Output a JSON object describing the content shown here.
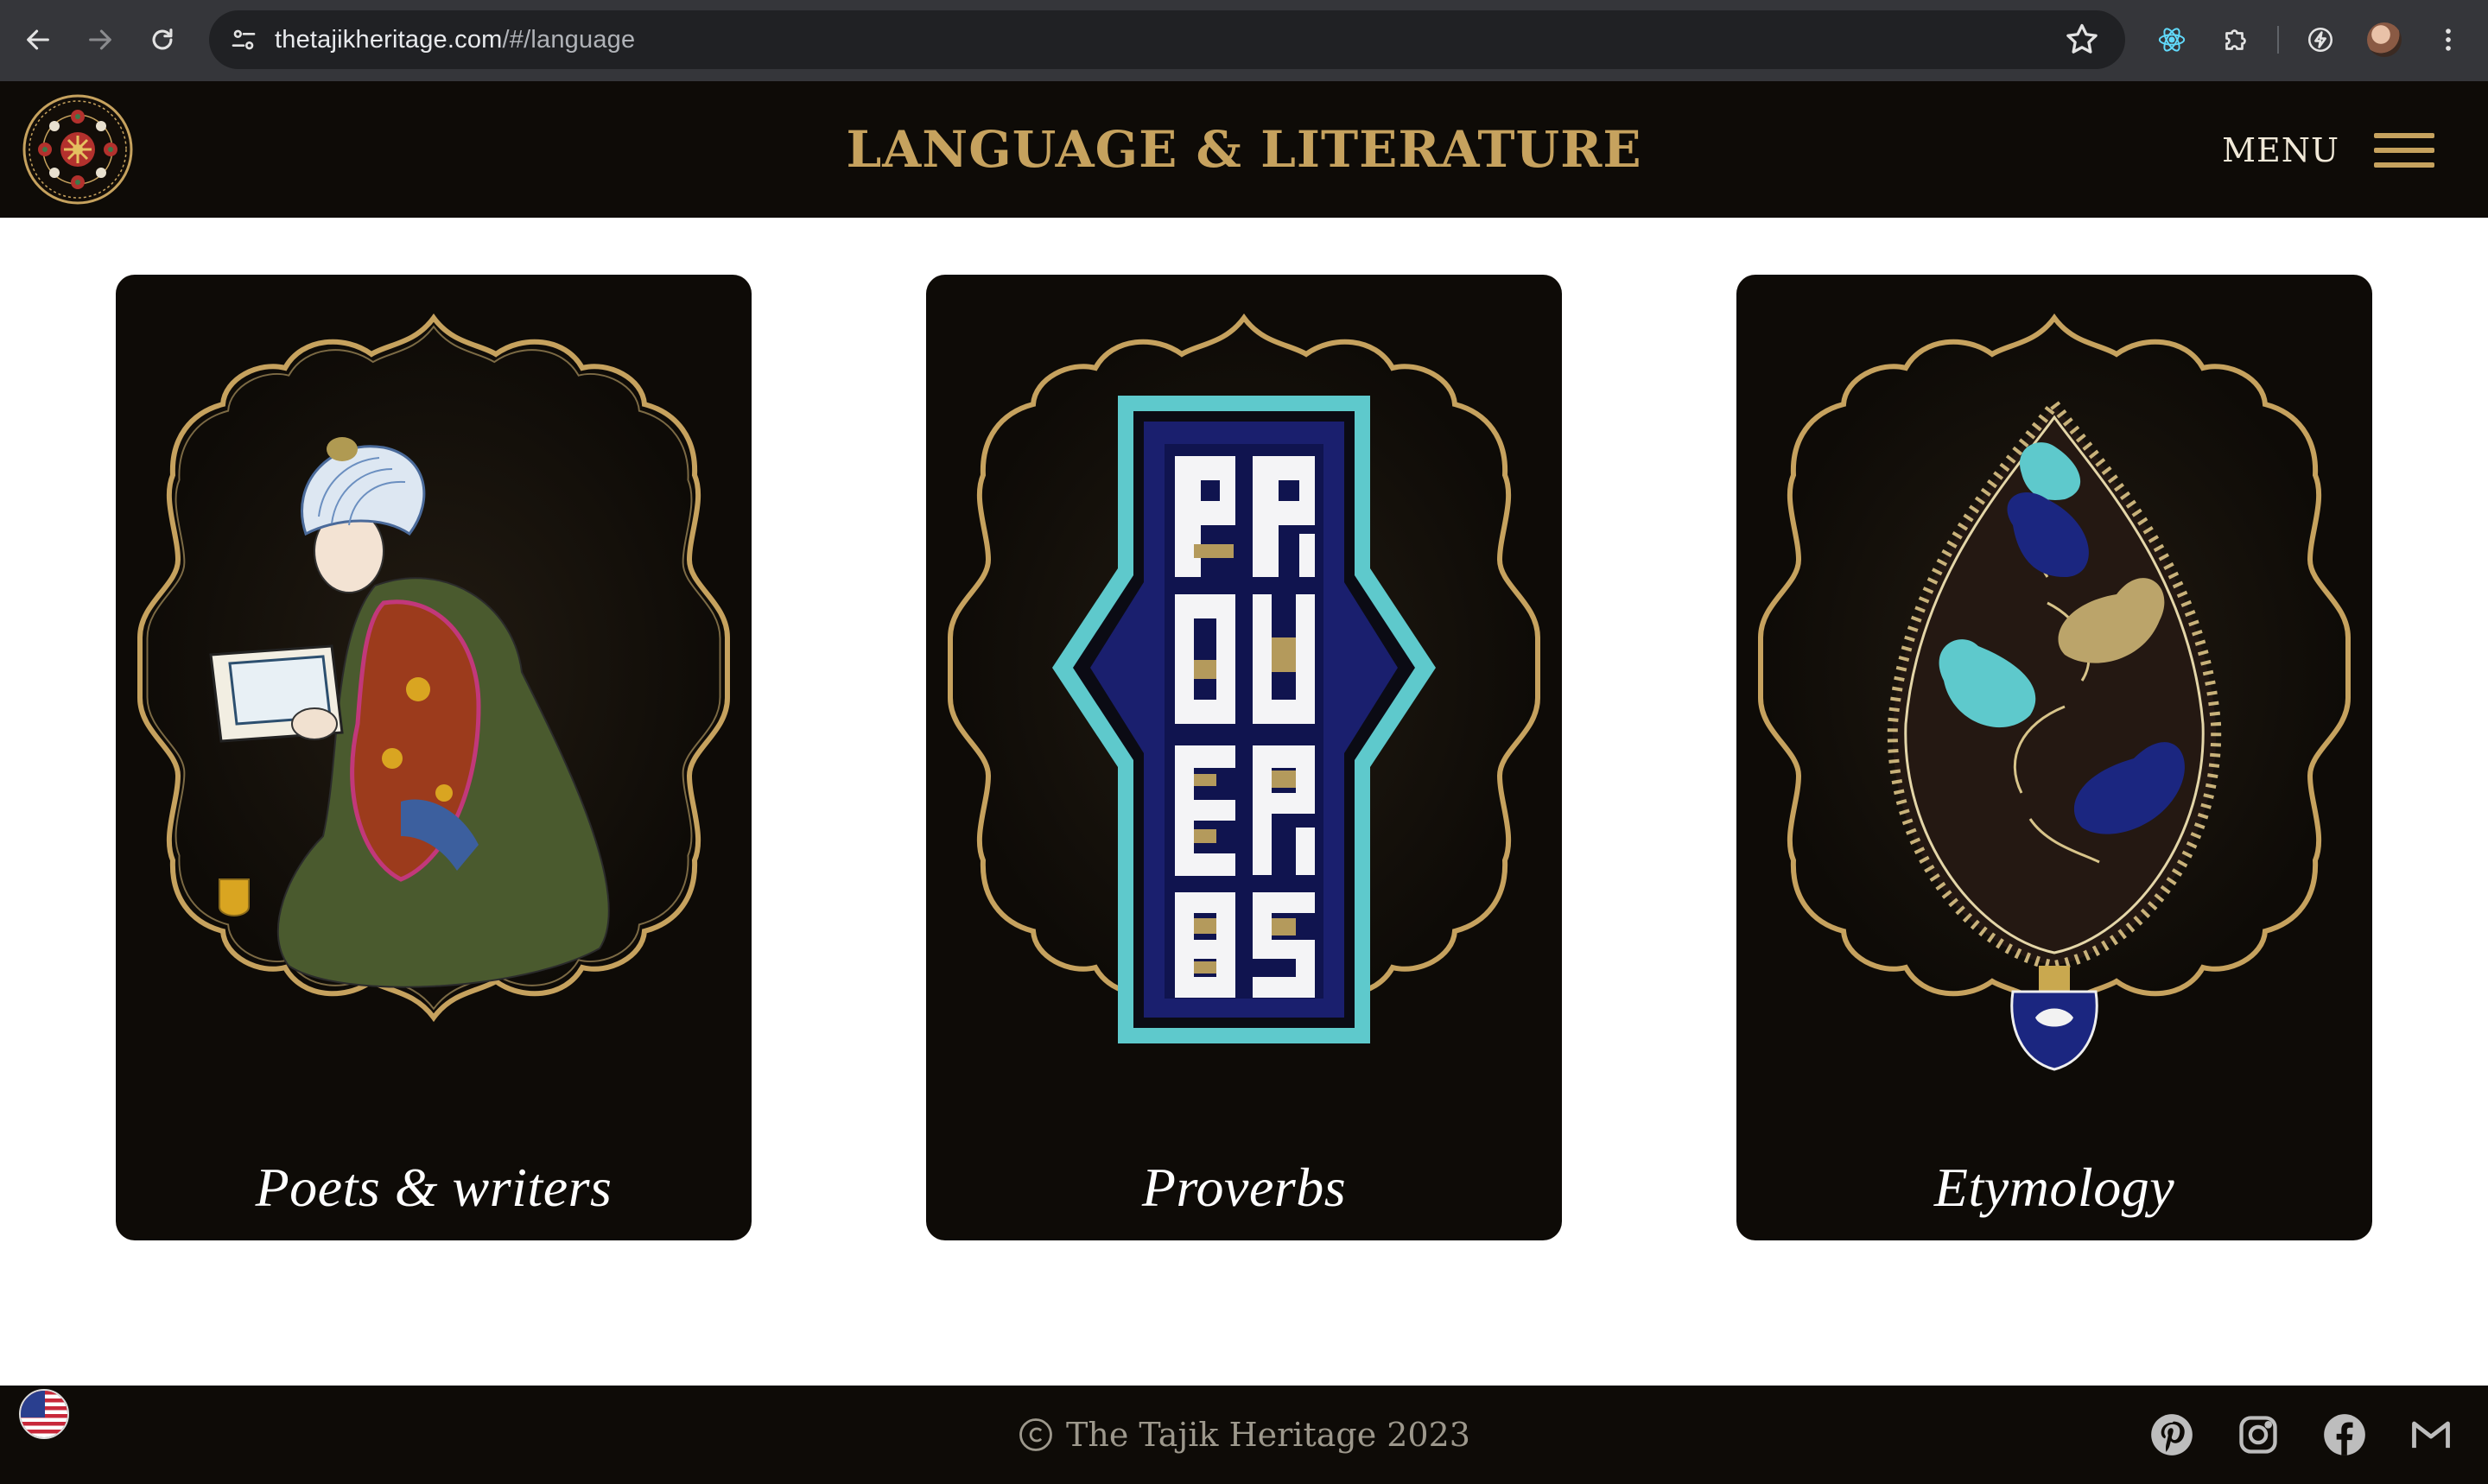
{
  "browser": {
    "url_host": "thetajikheritage.com",
    "url_path": "/#/language",
    "icons": {
      "back": "arrow-left-icon",
      "forward": "arrow-right-icon",
      "reload": "reload-icon",
      "site_info": "tune-icon",
      "bookmark": "star-icon",
      "extensions": [
        "react-devtools-icon",
        "puzzle-piece-icon",
        "lightning-icon",
        "profile-avatar",
        "kebab-menu-icon"
      ]
    }
  },
  "header": {
    "title": "LANGUAGE & LITERATURE",
    "menu_label": "MENU",
    "logo": "suzani-medallion-logo"
  },
  "cards": [
    {
      "label": "Poets & writers",
      "illustration": "seated-poet-miniature"
    },
    {
      "label": "Proverbs",
      "illustration": "kufic-square-proverbs"
    },
    {
      "label": "Etymology",
      "illustration": "paisley-language-tree"
    }
  ],
  "footer": {
    "copyright": "The Tajik Heritage 2023",
    "language_flag": "us-flag",
    "socials": [
      "pinterest-icon",
      "instagram-icon",
      "facebook-icon",
      "gmail-icon"
    ]
  },
  "colors": {
    "chrome_bg": "#35363a",
    "omnibox_bg": "#202124",
    "site_dark": "#0e0b07",
    "gold": "#c6a25e",
    "teal": "#5ec9cc",
    "navy": "#1a1f6e"
  }
}
